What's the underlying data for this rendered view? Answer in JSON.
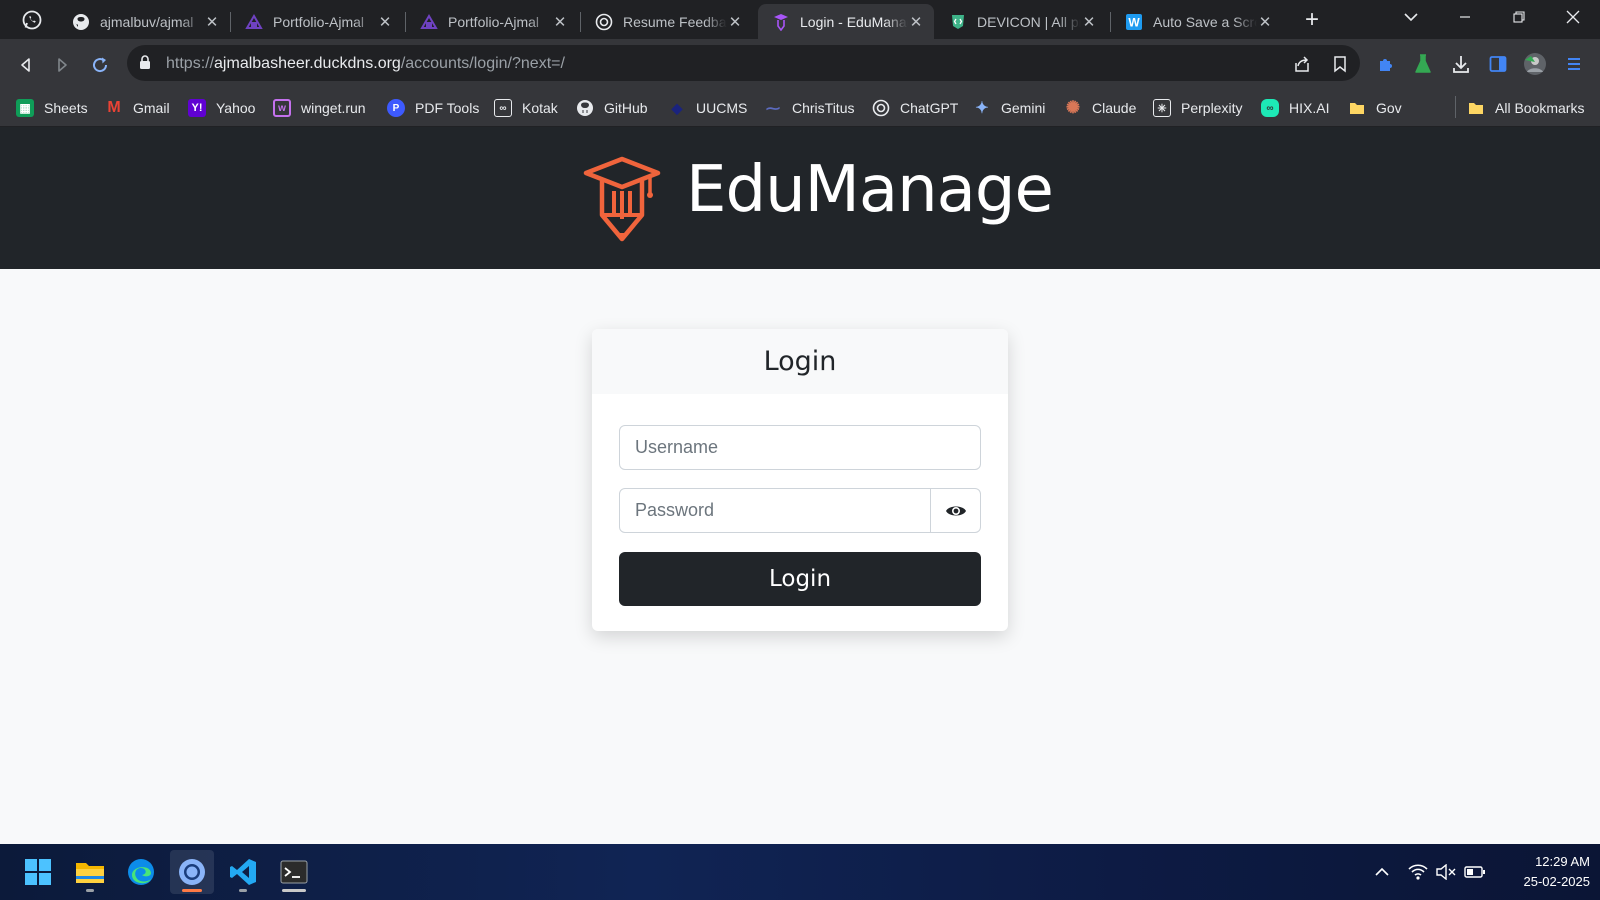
{
  "browser": {
    "tabs": [
      {
        "title": "ajmalbuv/ajmal",
        "favicon": "github-icon"
      },
      {
        "title": "Portfolio-Ajmal",
        "favicon": "portfolio-icon"
      },
      {
        "title": "Portfolio-Ajmal",
        "favicon": "portfolio-icon"
      },
      {
        "title": "Resume Feedback",
        "favicon": "chatgpt-icon"
      },
      {
        "title": "Login - EduManage",
        "favicon": "edumanage-icon",
        "active": true
      },
      {
        "title": "DEVICON | All programming",
        "favicon": "devicon-icon"
      },
      {
        "title": "Auto Save a Screenshot",
        "favicon": "word-icon"
      }
    ],
    "pinned_tab": "whatsapp-icon",
    "url_scheme": "https://",
    "url_host": "ajmalbasheer.duckdns.org",
    "url_path": "/accounts/login/?next=/",
    "bookmarks": [
      "Sheets",
      "Gmail",
      "Yahoo",
      "winget.run",
      "PDF Tools",
      "Kotak",
      "GitHub",
      "UUCMS",
      "ChrisTitus",
      "ChatGPT",
      "Gemini",
      "Claude",
      "Perplexity",
      "HIX.AI",
      "Gov"
    ],
    "all_bookmarks": "All Bookmarks"
  },
  "page": {
    "brand": "EduManage",
    "card_title": "Login",
    "username_placeholder": "Username",
    "password_placeholder": "Password",
    "login_button": "Login"
  },
  "taskbar": {
    "time": "12:29 AM",
    "date": "25-02-2025"
  },
  "colors": {
    "brand_orange": "#f0643c",
    "hero_bg": "#212529",
    "page_bg": "#f8f9fa",
    "button_bg": "#212529"
  }
}
